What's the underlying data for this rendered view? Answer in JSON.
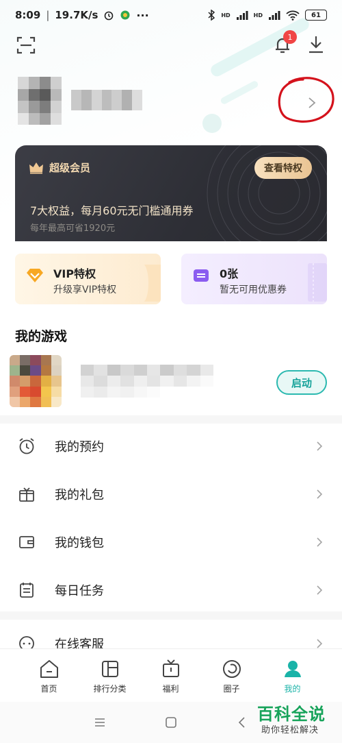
{
  "status_bar": {
    "time": "8:09",
    "speed": "19.7K/s",
    "more": "···",
    "signal_1": "HD",
    "signal_2": "HD",
    "battery": "61"
  },
  "header": {
    "notification_count": "1"
  },
  "vip_card": {
    "title": "超级会员",
    "view_button": "查看特权",
    "benefit": "7大权益，每月60元无门槛通用券",
    "savings": "每年最高可省1920元"
  },
  "privileges": [
    {
      "title": "VIP特权",
      "subtitle": "升级享VIP特权",
      "icon": "vip-diamond-icon"
    },
    {
      "title": "0张",
      "subtitle": "暂无可用优惠券",
      "icon": "coupon-icon"
    }
  ],
  "my_games": {
    "title": "我的游戏",
    "launch_button": "启动"
  },
  "menu": [
    {
      "label": "我的预约",
      "icon": "alarm-clock-icon"
    },
    {
      "label": "我的礼包",
      "icon": "gift-icon"
    },
    {
      "label": "我的钱包",
      "icon": "wallet-icon"
    },
    {
      "label": "每日任务",
      "icon": "calendar-task-icon"
    },
    {
      "label": "在线客服",
      "icon": "chat-bubble-icon"
    }
  ],
  "bottom_nav": [
    {
      "label": "首页",
      "icon": "home-icon"
    },
    {
      "label": "排行分类",
      "icon": "ranking-icon"
    },
    {
      "label": "福利",
      "icon": "welfare-icon"
    },
    {
      "label": "圈子",
      "icon": "circle-icon"
    },
    {
      "label": "我的",
      "icon": "profile-icon",
      "active": true
    }
  ],
  "watermark": {
    "title": "百科全说",
    "subtitle": "助你轻松解决"
  },
  "colors": {
    "accent": "#1ab3a8",
    "vip_gold": "#f3d9b1",
    "badge_red": "#f04545",
    "annotation_red": "#d4121c"
  }
}
